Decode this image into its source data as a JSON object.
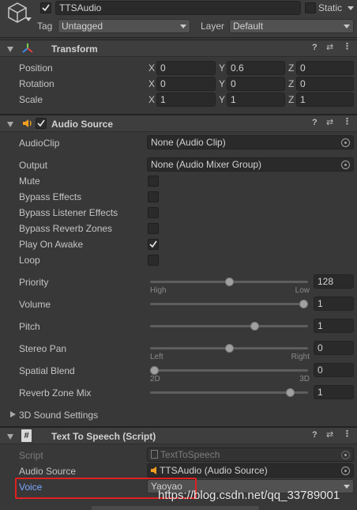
{
  "object": {
    "name": "TTSAudio",
    "static_label": "Static",
    "tag_label": "Tag",
    "tag_value": "Untagged",
    "layer_label": "Layer",
    "layer_value": "Default"
  },
  "transform": {
    "title": "Transform",
    "rows": [
      {
        "label": "Position",
        "x": "0",
        "y": "0.6",
        "z": "0"
      },
      {
        "label": "Rotation",
        "x": "0",
        "y": "0",
        "z": "0"
      },
      {
        "label": "Scale",
        "x": "1",
        "y": "1",
        "z": "1"
      }
    ],
    "axes": [
      "X",
      "Y",
      "Z"
    ]
  },
  "audio_source": {
    "title": "Audio Source",
    "audioclip_label": "AudioClip",
    "audioclip_value": "None (Audio Clip)",
    "output_label": "Output",
    "output_value": "None (Audio Mixer Group)",
    "toggles": [
      {
        "label": "Mute",
        "checked": false
      },
      {
        "label": "Bypass Effects",
        "checked": false
      },
      {
        "label": "Bypass Listener Effects",
        "checked": false
      },
      {
        "label": "Bypass Reverb Zones",
        "checked": false
      },
      {
        "label": "Play On Awake",
        "checked": true
      },
      {
        "label": "Loop",
        "checked": false
      }
    ],
    "priority": {
      "label": "Priority",
      "value": "128",
      "fraction": 0.5,
      "min_label": "High",
      "max_label": "Low"
    },
    "volume": {
      "label": "Volume",
      "value": "1",
      "fraction": 1.0
    },
    "pitch": {
      "label": "Pitch",
      "value": "1",
      "fraction": 0.67
    },
    "stereo_pan": {
      "label": "Stereo Pan",
      "value": "0",
      "fraction": 0.5,
      "min_label": "Left",
      "max_label": "Right"
    },
    "spatial_blend": {
      "label": "Spatial Blend",
      "value": "0",
      "fraction": 0.0,
      "min_label": "2D",
      "max_label": "3D"
    },
    "reverb_zone_mix": {
      "label": "Reverb Zone Mix",
      "value": "1",
      "fraction": 0.91
    },
    "sound_3d_label": "3D Sound Settings"
  },
  "tts_script": {
    "title": "Text To Speech (Script)",
    "script_label": "Script",
    "script_value": "TextToSpeech",
    "audio_source_label": "Audio Source",
    "audio_source_value": "TTSAudio (Audio Source)",
    "voice_label": "Voice",
    "voice_value": "Yaoyao"
  },
  "watermark": "https://blog.csdn.net/qq_33789001",
  "colors": {
    "background": "#383838",
    "field": "#2a2a2a",
    "highlight_red": "#e02020",
    "voice_label": "#7aa6ff",
    "audio_icon": "#f0a020"
  }
}
